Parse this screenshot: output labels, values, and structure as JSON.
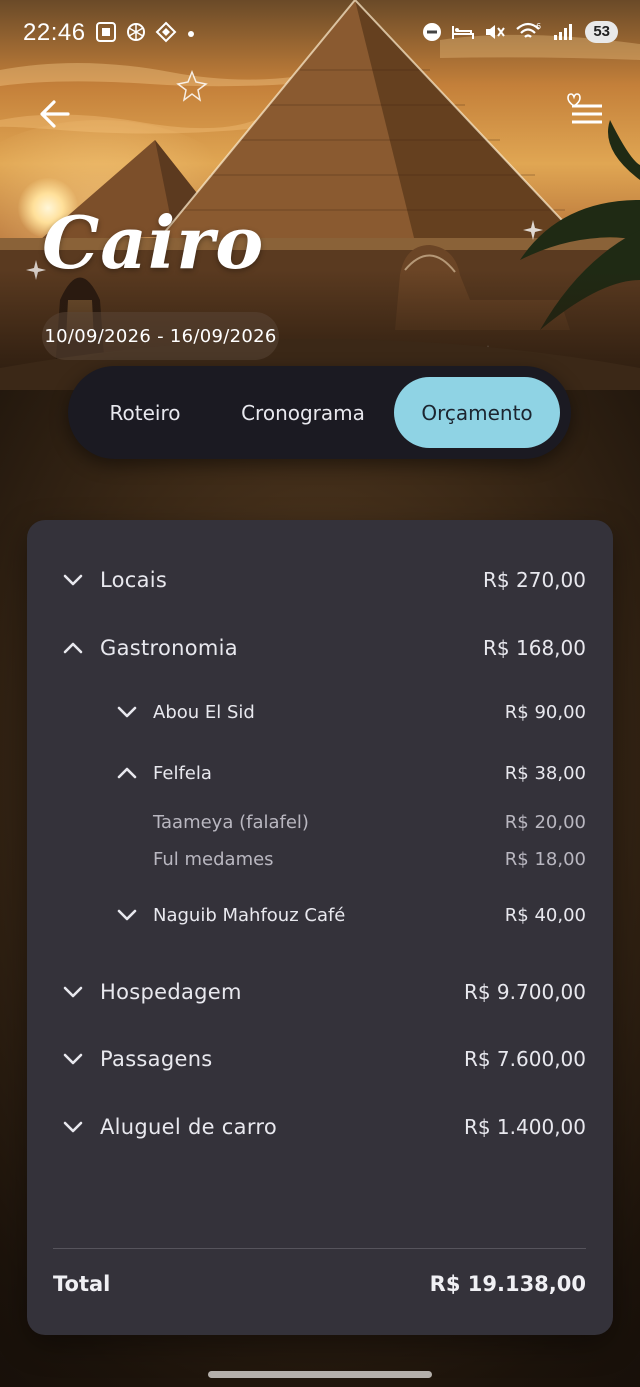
{
  "status_bar": {
    "time": "22:46",
    "battery": "53",
    "left_icons": [
      "screenshot-icon",
      "openai-icon",
      "gemini-icon",
      "dot-icon"
    ],
    "right_icons": [
      "do-not-disturb-icon",
      "bed-icon",
      "mute-icon",
      "wifi-icon",
      "signal-icon",
      "battery-icon"
    ]
  },
  "header": {
    "city": "Cairo",
    "dates": "10/09/2026 - 16/09/2026",
    "back_icon": "arrow-left-icon",
    "menu_icon": "heart-menu-icon"
  },
  "tabs": [
    {
      "label": "Roteiro",
      "active": false
    },
    {
      "label": "Cronograma",
      "active": false
    },
    {
      "label": "Orçamento",
      "active": true
    }
  ],
  "budget": {
    "categories": [
      {
        "label": "Locais",
        "amount": "R$ 270,00",
        "expanded": false
      },
      {
        "label": "Gastronomia",
        "amount": "R$ 168,00",
        "expanded": true,
        "restaurants": [
          {
            "label": "Abou El Sid",
            "amount": "R$ 90,00",
            "expanded": false
          },
          {
            "label": "Felfela",
            "amount": "R$ 38,00",
            "expanded": true,
            "items": [
              {
                "label": "Taameya (falafel)",
                "amount": "R$ 20,00"
              },
              {
                "label": "Ful medames",
                "amount": "R$ 18,00"
              }
            ]
          },
          {
            "label": "Naguib Mahfouz Café",
            "amount": "R$ 40,00",
            "expanded": false
          }
        ]
      },
      {
        "label": "Hospedagem",
        "amount": "R$ 9.700,00",
        "expanded": false
      },
      {
        "label": "Passagens",
        "amount": "R$ 7.600,00",
        "expanded": false
      },
      {
        "label": "Aluguel de carro",
        "amount": "R$ 1.400,00",
        "expanded": false
      }
    ],
    "total_label": "Total",
    "total_amount": "R$ 19.138,00"
  },
  "colors": {
    "active_tab": "#8fd3e4",
    "tab_bar": "#1b1a22",
    "card": "#34323a"
  }
}
